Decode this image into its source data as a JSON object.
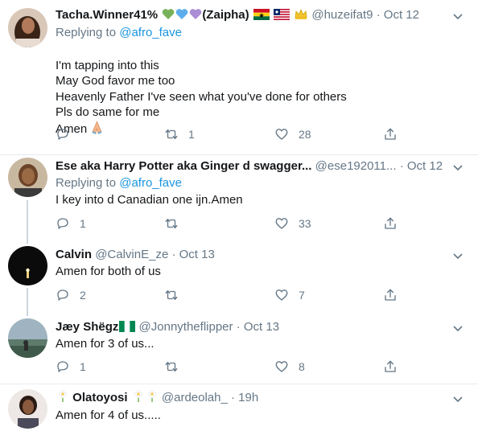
{
  "tweets": [
    {
      "name": "Tacha.Winner41%",
      "name_suffix": "(Zaipha)",
      "handle": "@huzeifat9",
      "time": "Oct 12",
      "replying_label": "Replying to",
      "replying_to": "@afro_fave",
      "text": "I'm tapping into this\nMay God favor me too\nHeavenly Father I've seen what you've done for others\nPls do same for me\nAmen",
      "replies": "",
      "retweets": "1",
      "likes": "28"
    },
    {
      "name": "Ese aka Harry Potter aka Ginger d swagger...",
      "handle": "@ese192011...",
      "time": "Oct 12",
      "replying_label": "Replying to",
      "replying_to": "@afro_fave",
      "text": "I key into d Canadian one ijn.Amen",
      "replies": "1",
      "retweets": "",
      "likes": "33"
    },
    {
      "name": "Calvin",
      "handle": "@CalvinE_ze",
      "time": "Oct 13",
      "text": "Amen for both of us",
      "replies": "2",
      "retweets": "",
      "likes": "7"
    },
    {
      "name": "Jæy Shëgz",
      "handle": "@Jonnytheflipper",
      "time": "Oct 13",
      "text": "Amen for 3 of us...",
      "replies": "1",
      "retweets": "",
      "likes": "8"
    },
    {
      "name": "Olatoyosi",
      "handle": "@ardeolah_",
      "time": "19h",
      "text": "Amen for 4 of us....."
    }
  ],
  "separator": "·",
  "colors": {
    "text": "#14171a",
    "muted": "#657786",
    "link": "#1b95e0",
    "divider": "#e6ecf0",
    "thread_line": "#ccd6dd"
  },
  "icons": [
    "reply-icon",
    "retweet-icon",
    "like-icon",
    "share-icon",
    "chevron-down-icon",
    "green-heart-icon",
    "blue-heart-icon",
    "purple-heart-icon",
    "ghana-flag-icon",
    "liberia-flag-icon",
    "crown-icon",
    "folded-hands-icon",
    "nigeria-flag-icon",
    "flower-icon"
  ]
}
